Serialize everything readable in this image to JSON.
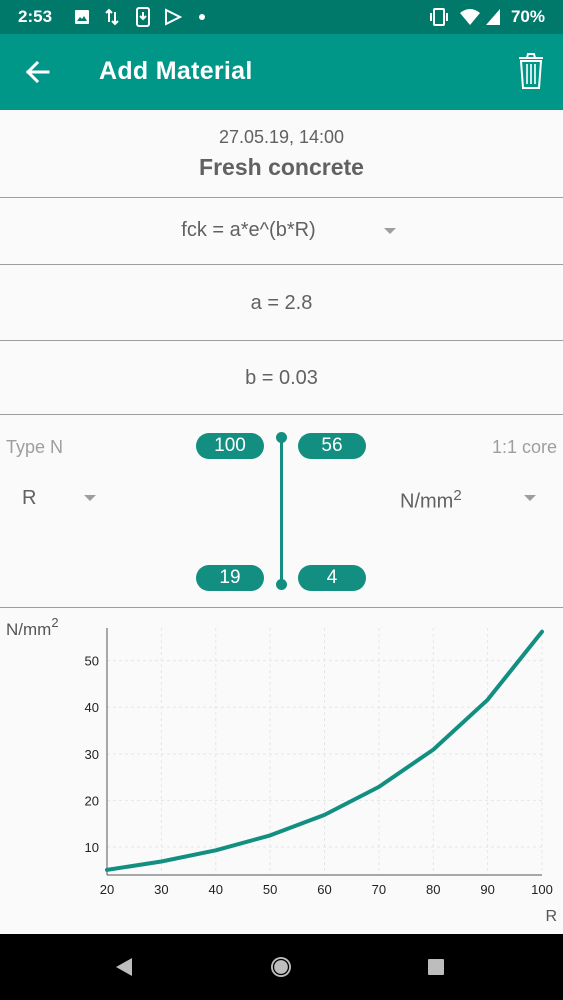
{
  "status": {
    "time": "2:53",
    "battery": "70%",
    "icons": [
      "image-icon",
      "data-transfer-icon",
      "download-icon",
      "play-store-icon",
      "dot-icon",
      "vibrate-icon",
      "wifi-icon",
      "signal-icon",
      "battery-icon"
    ]
  },
  "app_bar": {
    "title": "Add Material",
    "back_icon": "arrow-back-icon",
    "delete_icon": "trash-icon"
  },
  "header": {
    "date": "27.05.19, 14:00",
    "material_name": "Fresh concrete"
  },
  "formula": {
    "selected": "fck = a*e^(b*R)"
  },
  "param_a": "a = 2.8",
  "param_b": "b = 0.03",
  "mapping": {
    "left_label": "Type N",
    "right_label": "1:1 core",
    "left_unit": "R",
    "right_unit_base": "N/mm",
    "right_unit_exp": "2",
    "top_left": "100",
    "top_right": "56",
    "bottom_left": "19",
    "bottom_right": "4"
  },
  "chart_data": {
    "type": "line",
    "ylabel_base": "N/mm",
    "ylabel_exp": "2",
    "xlabel": "R",
    "xlim": [
      20,
      100
    ],
    "ylim": [
      4,
      57
    ],
    "xticks": [
      20,
      30,
      40,
      50,
      60,
      70,
      80,
      90,
      100
    ],
    "yticks": [
      10,
      20,
      30,
      40,
      50
    ],
    "grid": true,
    "series": [
      {
        "color": "#138f82",
        "x": [
          20,
          30,
          40,
          50,
          60,
          70,
          80,
          90,
          100
        ],
        "y": [
          5.1,
          6.9,
          9.3,
          12.5,
          16.9,
          22.9,
          30.9,
          41.6,
          56.2
        ]
      }
    ]
  },
  "colors": {
    "primary": "#009688",
    "primary_dark": "#00796b",
    "accent": "#138f82"
  }
}
